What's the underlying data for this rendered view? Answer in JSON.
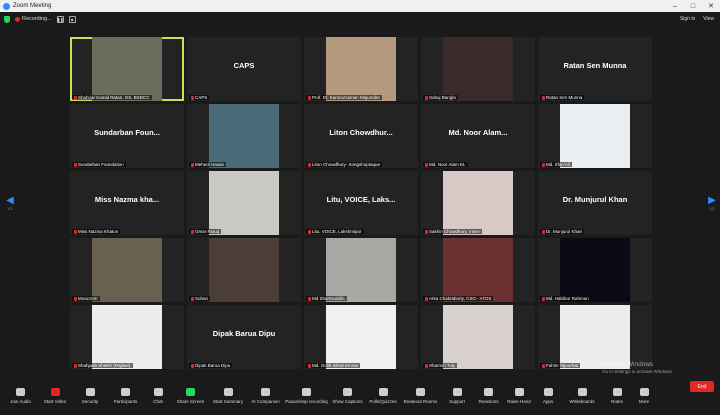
{
  "window": {
    "title": "Zoom Meeting"
  },
  "topbar": {
    "recording": "Recording...",
    "sign_in": "Sign in",
    "view": "View"
  },
  "tiles": [
    {
      "label": "Shahriar Kamal Ratan, GS, BSDCC",
      "big": "",
      "active": true,
      "video": "#6b6b5e"
    },
    {
      "label": "CAPS",
      "big": "CAPS",
      "video": ""
    },
    {
      "label": "Prof. Dr. Kamruzzaman Majumder",
      "big": "",
      "video": "#b39a7e"
    },
    {
      "label": "Sobuj Bangla",
      "big": "",
      "video": "#3a2a2a"
    },
    {
      "label": "Ratan Sen Munna",
      "big": "Ratan Sen Munna",
      "video": ""
    },
    {
      "label": "Sundarban Foundation",
      "big": "Sundarban Foun...",
      "video": ""
    },
    {
      "label": "Mehedi Hasan",
      "big": "",
      "video": "#4a6b7a"
    },
    {
      "label": "Liton Chowdhury- Songshoptaque",
      "big": "Liton Chowdhur...",
      "video": ""
    },
    {
      "label": "Md. Noor Alam EL",
      "big": "Md. Noor Alam...",
      "video": ""
    },
    {
      "label": "Md. Irfan Ali",
      "big": "",
      "video": "#e8eef2"
    },
    {
      "label": "Miss Nazma Khatun",
      "big": "Miss Nazma kha...",
      "video": ""
    },
    {
      "label": "Omar Faruq",
      "big": "",
      "video": "#c9c9c4"
    },
    {
      "label": "Litu, VOICE, Lakshmipur",
      "big": "Litu, VOICE, Laks...",
      "video": ""
    },
    {
      "label": "Sakhin Chowdhury, Intern",
      "big": "",
      "video": "#d8c8c6"
    },
    {
      "label": "Dr. Munjurul Khan",
      "big": "Dr. Munjurul Khan",
      "video": ""
    },
    {
      "label": "Moazzem",
      "big": "",
      "video": "#6a6050"
    },
    {
      "label": "Sohan",
      "big": "",
      "video": "#4c3e36"
    },
    {
      "label": "Md Shamsuddin",
      "big": "",
      "video": "#a8a8a4"
    },
    {
      "label": "Arka Chakraborty, CSO - ATDS",
      "big": "",
      "video": "#6c3030"
    },
    {
      "label": "Md. Habibur Rahman",
      "big": "",
      "video": "#0a0a14"
    },
    {
      "label": "Shahjada Sheikh (Rajbari)",
      "big": "",
      "video": "#ececec"
    },
    {
      "label": "Dipak Barua Dipu",
      "big": "Dipak Barua Dipu",
      "video": ""
    },
    {
      "label": "Md. Golib Ishrat Emran",
      "big": "",
      "video": "#f0f0f0"
    },
    {
      "label": "Sharmin Tuly",
      "big": "",
      "video": "#d8d0cc"
    },
    {
      "label": "Fahim Tajnurhat",
      "big": "",
      "video": "#ececec"
    }
  ],
  "pager": {
    "left": "1/2",
    "right": "1/2"
  },
  "toolbar": [
    {
      "name": "join-audio",
      "label": "Join Audio"
    },
    {
      "name": "start-video",
      "label": "Start Video",
      "color": "red"
    },
    {
      "name": "security",
      "label": "Security"
    },
    {
      "name": "participants",
      "label": "Participants"
    },
    {
      "name": "chat",
      "label": "Chat"
    },
    {
      "name": "share-screen",
      "label": "Share Screen",
      "color": "green"
    },
    {
      "name": "start-summary",
      "label": "Start Summary"
    },
    {
      "name": "ai-companion",
      "label": "AI Companion"
    },
    {
      "name": "pause-stop-recording",
      "label": "Pause/stop recording"
    },
    {
      "name": "show-captions",
      "label": "Show Captions"
    },
    {
      "name": "polls-quizzes",
      "label": "Polls/Quizzes"
    },
    {
      "name": "breakout-rooms",
      "label": "Breakout Rooms"
    },
    {
      "name": "support",
      "label": "Support"
    },
    {
      "name": "reactions",
      "label": "Reactions"
    },
    {
      "name": "raise-hand",
      "label": "Raise Hand"
    },
    {
      "name": "apps",
      "label": "Apps"
    },
    {
      "name": "whiteboards",
      "label": "Whiteboards"
    },
    {
      "name": "notes",
      "label": "Notes"
    },
    {
      "name": "more",
      "label": "More"
    }
  ],
  "end_label": "End",
  "watermark": {
    "title": "Activate Windows",
    "subtitle": "Go to Settings to activate Windows."
  }
}
